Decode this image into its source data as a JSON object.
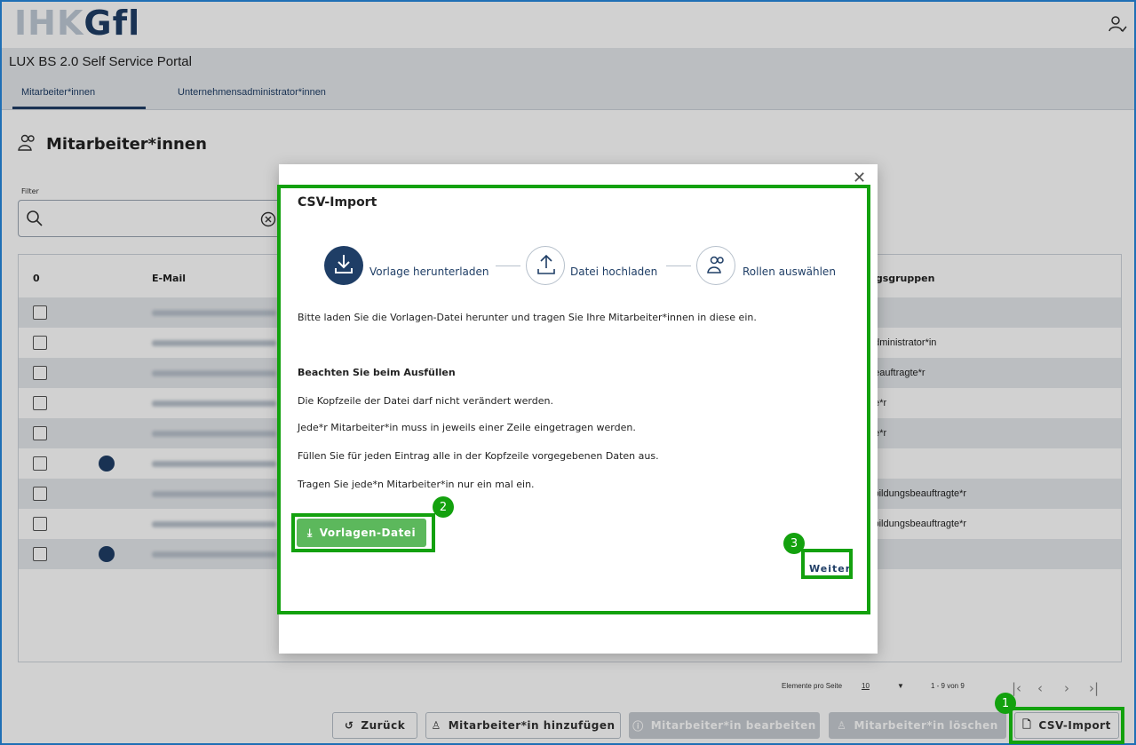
{
  "header": {
    "logo_ihk": "IHK",
    "logo_gfi": "Gfl",
    "portal_title": "LUX BS 2.0 Self Service Portal"
  },
  "tabs": [
    {
      "label": "Mitarbeiter*innen",
      "active": true
    },
    {
      "label": "Unternehmensadministrator*innen",
      "active": false
    }
  ],
  "page": {
    "title": "Mitarbeiter*innen",
    "filter_label": "Filter"
  },
  "table": {
    "headers": [
      "0",
      "E-Mail",
      "ngsgruppen"
    ],
    "rows": [
      {
        "alt": true,
        "role": "",
        "avatar": false
      },
      {
        "alt": false,
        "role": "administrator*in",
        "avatar": false
      },
      {
        "alt": true,
        "role": "beauftragte*r",
        "avatar": false
      },
      {
        "alt": false,
        "role": "de*r",
        "avatar": false
      },
      {
        "alt": true,
        "role": "de*r",
        "avatar": false
      },
      {
        "alt": false,
        "role": "",
        "avatar": true
      },
      {
        "alt": true,
        "role": "sbildungsbeauftragte*r",
        "avatar": false
      },
      {
        "alt": false,
        "role": "sbildungsbeauftragte*r",
        "avatar": false
      },
      {
        "alt": true,
        "role": "",
        "avatar": true
      }
    ]
  },
  "pagination": {
    "per_page_label": "Elemente pro Seite",
    "per_page_value": "10",
    "range": "1 - 9 von 9"
  },
  "buttons": {
    "back": "Zurück",
    "add": "Mitarbeiter*in hinzufügen",
    "edit": "Mitarbeiter*in bearbeiten",
    "delete": "Mitarbeiter*in löschen",
    "csv": "CSV-Import"
  },
  "modal": {
    "title": "CSV-Import",
    "steps": [
      "Vorlage herunterladen",
      "Datei hochladen",
      "Rollen auswählen"
    ],
    "intro": "Bitte laden Sie die Vorlagen-Datei herunter und tragen Sie Ihre Mitarbeiter*innen in diese ein.",
    "heading": "Beachten Sie beim Ausfüllen",
    "rules": [
      "Die Kopfzeile der Datei darf nicht verändert werden.",
      "Jede*r Mitarbeiter*in muss in jeweils einer Zeile eingetragen werden.",
      "Füllen Sie für jeden Eintrag alle in der Kopfzeile vorgegebenen Daten aus.",
      "Tragen Sie jede*n Mitarbeiter*in nur ein mal ein."
    ],
    "download_label": "Vorlagen-Datei",
    "next_label": "Weiter"
  },
  "badges": [
    "1",
    "2",
    "3"
  ],
  "colors": {
    "brand": "#1f3e66",
    "highlight": "#13a10e",
    "download": "#5cb85c"
  }
}
